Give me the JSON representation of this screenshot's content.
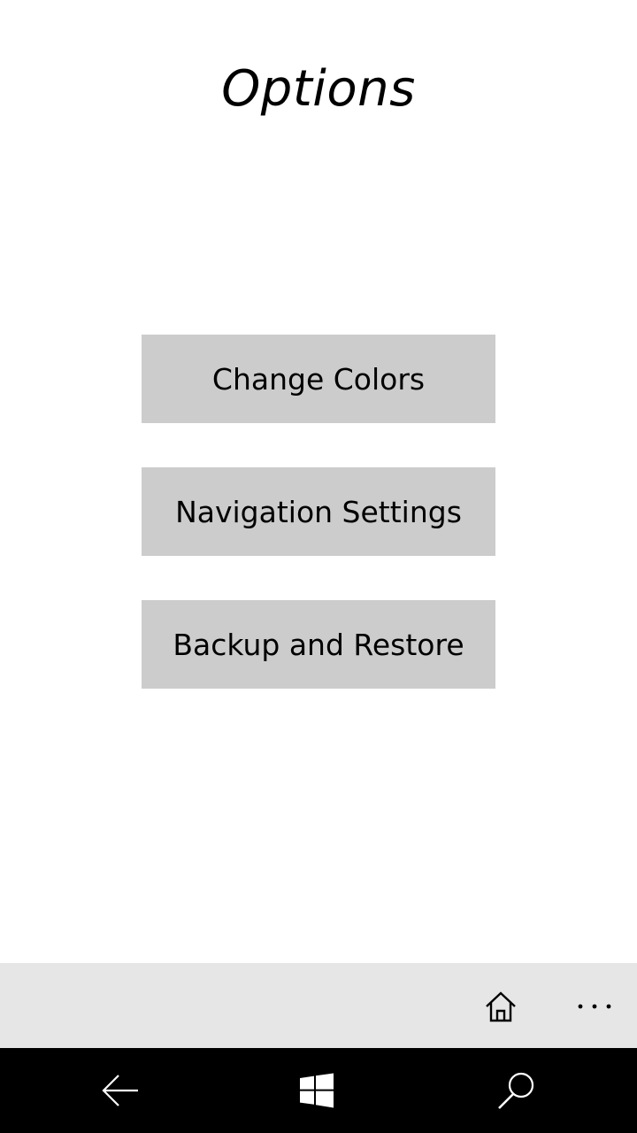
{
  "page": {
    "title": "Options"
  },
  "options": [
    {
      "label": "Change Colors",
      "name": "change-colors-button"
    },
    {
      "label": "Navigation Settings",
      "name": "navigation-settings-button"
    },
    {
      "label": "Backup and Restore",
      "name": "backup-and-restore-button"
    }
  ],
  "app_bar": {
    "icons": [
      "home-icon",
      "more-icon"
    ]
  },
  "nav_bar": {
    "icons": [
      "back-arrow-icon",
      "windows-start-icon",
      "search-icon"
    ]
  },
  "colors": {
    "background": "#ffffff",
    "button_fill": "#cccccc",
    "app_bar": "#e6e6e6",
    "nav_bar": "#000000",
    "text": "#000000",
    "nav_icon": "#ffffff"
  }
}
